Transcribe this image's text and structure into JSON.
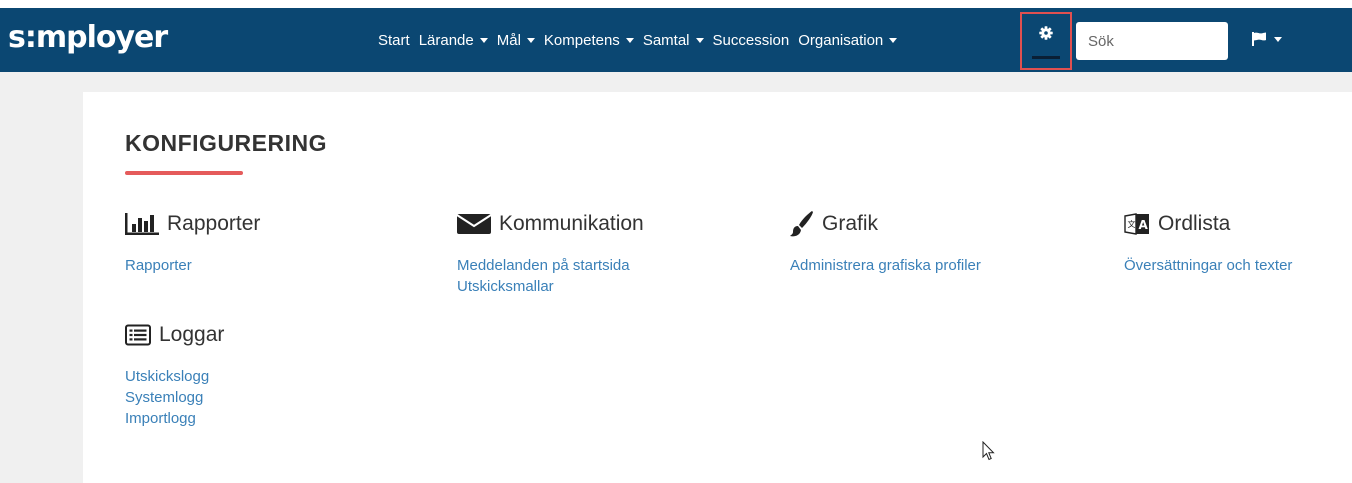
{
  "app": {
    "logo": "s:mployer"
  },
  "nav": {
    "items": [
      {
        "label": "Start",
        "has_caret": false
      },
      {
        "label": "Lärande",
        "has_caret": true
      },
      {
        "label": "Mål",
        "has_caret": true
      },
      {
        "label": "Kompetens",
        "has_caret": true
      },
      {
        "label": "Samtal",
        "has_caret": true
      },
      {
        "label": "Succession",
        "has_caret": false
      },
      {
        "label": "Organisation",
        "has_caret": true
      }
    ],
    "search_placeholder": "Sök",
    "settings_icon": "gear-icon",
    "language_icon": "flag-icon"
  },
  "page": {
    "title": "KONFIGURERING",
    "sections": {
      "rapporter": {
        "title": "Rapporter",
        "icon": "bar-chart-icon",
        "links": [
          "Rapporter"
        ]
      },
      "kommunikation": {
        "title": "Kommunikation",
        "icon": "envelope-icon",
        "links": [
          "Meddelanden på startsida",
          "Utskicksmallar"
        ]
      },
      "grafik": {
        "title": "Grafik",
        "icon": "paintbrush-icon",
        "links": [
          "Administrera grafiska profiler"
        ]
      },
      "ordlista": {
        "title": "Ordlista",
        "icon": "translate-icon",
        "links": [
          "Översättningar och texter"
        ]
      },
      "loggar": {
        "title": "Loggar",
        "icon": "list-icon",
        "links": [
          "Utskickslogg",
          "Systemlogg",
          "Importlogg"
        ]
      }
    }
  },
  "colors": {
    "navbar": "#0b4772",
    "link": "#3a80b8",
    "accent_underline": "#e55b5b",
    "highlight_box": "#e05050"
  }
}
